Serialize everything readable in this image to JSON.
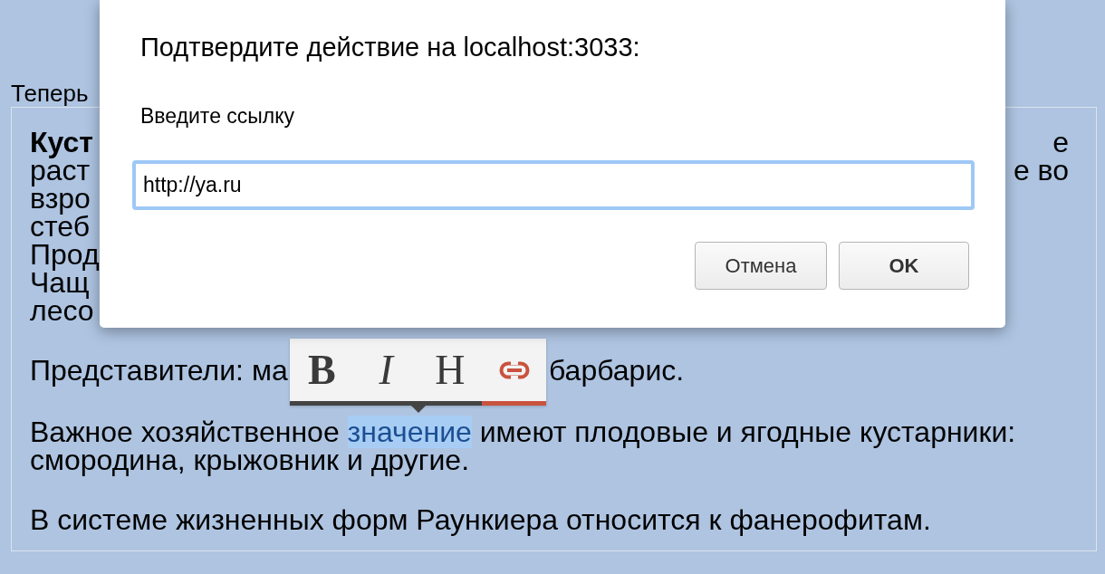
{
  "page_label": "Теперь",
  "editor": {
    "paragraphs": [
      {
        "kind": "clipped",
        "lines": [
          {
            "left": "Куст",
            "bold": true,
            "right": "е"
          },
          {
            "left": "раст",
            "bold": false,
            "right": "е во"
          },
          {
            "left": "взро",
            "bold": false
          },
          {
            "left": "стеб",
            "bold": false
          },
          {
            "left": "Прод",
            "bold": false
          },
          {
            "left": "Чащ",
            "bold": false
          },
          {
            "left": "лесо",
            "bold": false
          }
        ]
      },
      {
        "kind": "split",
        "left": "Представители: ма",
        "right": "барбарис."
      },
      {
        "kind": "text",
        "segments": [
          {
            "text": "Важное хозяйственное ",
            "selected": false
          },
          {
            "text": "значение",
            "selected": true
          },
          {
            "text": " имеют плодовые и ягодные кустарники: смородина, крыжовник и другие.",
            "selected": false
          }
        ]
      },
      {
        "kind": "text",
        "segments": [
          {
            "text": "В системе жизненных форм Раункиера относится к фанерофитам.",
            "selected": false
          }
        ]
      }
    ]
  },
  "toolbar": {
    "buttons": [
      {
        "kind": "bold",
        "label": "B",
        "active": false
      },
      {
        "kind": "italic",
        "label": "I",
        "active": false
      },
      {
        "kind": "heading",
        "label": "H",
        "active": false
      },
      {
        "kind": "link",
        "active": true
      }
    ]
  },
  "dialog": {
    "title": "Подтвердите действие на localhost:3033:",
    "message": "Введите ссылку",
    "value": "http://ya.ru",
    "buttons": [
      {
        "kind": "cancel",
        "label": "Отмена"
      },
      {
        "kind": "ok",
        "label": "OK"
      }
    ]
  }
}
